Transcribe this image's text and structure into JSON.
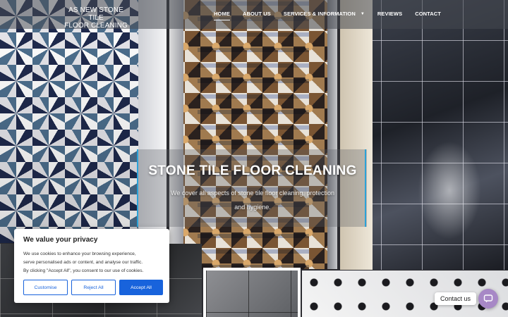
{
  "header": {
    "logo_line1": "AS NEW STONE TILE",
    "logo_line2": "FLOOR CLEANING",
    "nav": [
      {
        "label": "HOME",
        "active": true
      },
      {
        "label": "ABOUT US"
      },
      {
        "label": "SERVICES & INFORMATION",
        "has_dropdown": true
      },
      {
        "label": "REVIEWS"
      },
      {
        "label": "CONTACT"
      }
    ]
  },
  "hero": {
    "title": "STONE TILE FLOOR CLEANING",
    "subtitle_line1": "We cover all aspects of stone tile floor cleaning, protection",
    "subtitle_line2": "and hygiene."
  },
  "cookie": {
    "title": "We value your privacy",
    "text_line1": "We use cookies to enhance your browsing experience,",
    "text_line2": "serve personalised ads or content, and analyse our traffic.",
    "text_line3": "By clicking \"Accept All\", you consent to our use of cookies.",
    "customise_label": "Customise",
    "reject_label": "Reject All",
    "accept_label": "Accept All"
  },
  "contact_widget": {
    "label": "Contact us",
    "icon": "chat-bubble-icon",
    "color": "#a788c6"
  },
  "colors": {
    "accent_blue": "#2aa2d8",
    "cookie_blue": "#1863dc"
  }
}
